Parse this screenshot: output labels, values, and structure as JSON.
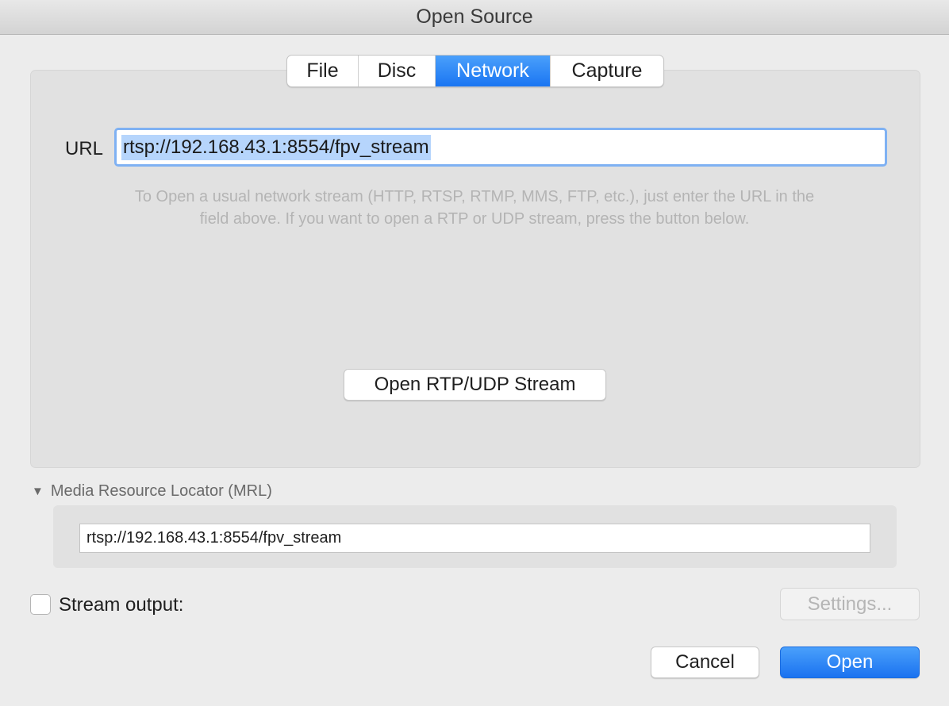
{
  "window": {
    "title": "Open Source"
  },
  "tabs": [
    {
      "label": "File",
      "active": false
    },
    {
      "label": "Disc",
      "active": false
    },
    {
      "label": "Network",
      "active": true
    },
    {
      "label": "Capture",
      "active": false
    }
  ],
  "network": {
    "url_label": "URL",
    "url_value": "rtsp://192.168.43.1:8554/fpv_stream",
    "hint_line1": "To Open a usual network stream (HTTP, RTSP, RTMP, MMS, FTP, etc.), just enter the URL in the",
    "hint_line2": "field above. If you want to open a RTP or UDP stream, press the button below.",
    "rtp_button": "Open RTP/UDP Stream"
  },
  "mrl": {
    "toggle_label": "Media Resource Locator (MRL)",
    "value": "rtsp://192.168.43.1:8554/fpv_stream",
    "expanded": true,
    "toggle_icon": "disclosure-triangle-down"
  },
  "stream_output": {
    "label": "Stream output:",
    "checked": false
  },
  "buttons": {
    "settings": "Settings...",
    "cancel": "Cancel",
    "open": "Open"
  },
  "colors": {
    "accent": "#1a75f2",
    "selection": "#b6d5fc",
    "focus_ring": "#7fb1f3"
  }
}
